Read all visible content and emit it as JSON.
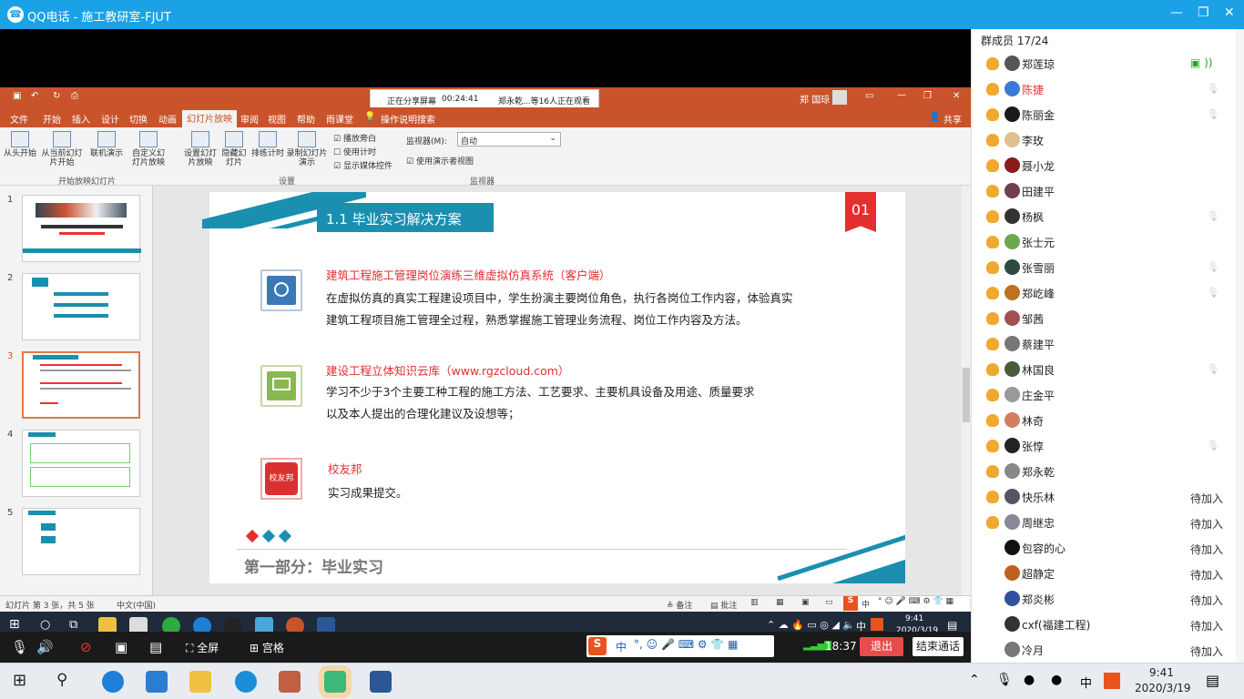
{
  "qq": {
    "title": "QQ电话 - 施工教研室-FJUT"
  },
  "ppt": {
    "share_status": "正在分享屏幕",
    "share_time": "00:24:41",
    "share_viewers": "郑永乾...等16人正在观看",
    "user": "郑 国琼",
    "share_btn": "共享",
    "tabs": [
      "文件",
      "开始",
      "插入",
      "设计",
      "切换",
      "动画",
      "幻灯片放映",
      "审阅",
      "视图",
      "帮助",
      "雨课堂"
    ],
    "tell_me": "操作说明搜索",
    "ribbon": {
      "from_start": "从头开始",
      "from_current": "从当前幻灯片开始",
      "online": "联机演示",
      "custom": "自定义幻灯片放映",
      "group1": "开始放映幻灯片",
      "setup": "设置幻灯片放映",
      "hide": "隐藏幻灯片",
      "rehearse": "排练计时",
      "record": "录制幻灯片演示",
      "chk_narration": "播放旁白",
      "chk_timing": "使用计时",
      "chk_media": "显示媒体控件",
      "group2": "设置",
      "monitor_label": "监视器(M):",
      "monitor_value": "自动",
      "presenter": "使用演示者视图",
      "group3": "监视器"
    },
    "thumb_numbers": [
      "1",
      "2",
      "3",
      "4",
      "5"
    ],
    "status": {
      "slide": "幻灯片 第 3 张，共 5 张",
      "lang": "中文(中国)",
      "notes": "备注",
      "comments": "批注"
    },
    "slide": {
      "section_title": "1.1 毕业实习解决方案",
      "badge": "01",
      "item1_title": "建筑工程施工管理岗位演练三维虚拟仿真系统（客户端）",
      "item1_line1": "在虚拟仿真的真实工程建设项目中，学生扮演主要岗位角色，执行各岗位工作内容，体验真实",
      "item1_line2": "建筑工程项目施工管理全过程，熟悉掌握施工管理业务流程、岗位工作内容及方法。",
      "item2_title": "建设工程立体知识云库（www.rgzcloud.com）",
      "item2_line1": "学习不少于3个主要工种工程的施工方法、工艺要求、主要机具设备及用途、质量要求",
      "item2_line2": "以及本人提出的合理化建议及设想等；",
      "item3_title": "校友邦",
      "item3_icon": "校友邦",
      "item3_line1": "实习成果提交。",
      "footer": "第一部分：毕业实习"
    },
    "inner_clock": {
      "time": "9:41",
      "date": "2020/3/19"
    },
    "inner_tray_lang": "中"
  },
  "call": {
    "fullscreen": "全屏",
    "grid": "宫格",
    "duration": "18:37",
    "exit": "退出",
    "end": "结束通话",
    "ime_lang": "中"
  },
  "members": {
    "header": "群成员 17/24",
    "list": [
      {
        "name": "郑莲琼",
        "status": "",
        "color": "#555",
        "red": false
      },
      {
        "name": "陈捷",
        "status": "",
        "color": "#3a7bd5",
        "red": true
      },
      {
        "name": "陈丽金",
        "status": "",
        "color": "#1a1a1a",
        "red": false
      },
      {
        "name": "李玫",
        "status": "",
        "color": "#e0c090",
        "red": false
      },
      {
        "name": "聂小龙",
        "status": "",
        "color": "#8b1a1a",
        "red": false
      },
      {
        "name": "田建平",
        "status": "",
        "color": "#704050",
        "red": false
      },
      {
        "name": "杨枫",
        "status": "",
        "color": "#333",
        "red": false
      },
      {
        "name": "张士元",
        "status": "",
        "color": "#6aa84f",
        "red": false
      },
      {
        "name": "张雪丽",
        "status": "",
        "color": "#2d4a3e",
        "red": false
      },
      {
        "name": "郑屹峰",
        "status": "",
        "color": "#c07020",
        "red": false
      },
      {
        "name": "邹茜",
        "status": "",
        "color": "#a05050",
        "red": false
      },
      {
        "name": "蔡建平",
        "status": "",
        "color": "#777",
        "red": false
      },
      {
        "name": "林国良",
        "status": "",
        "color": "#4a5a3a",
        "red": false
      },
      {
        "name": "庄金平",
        "status": "",
        "color": "#999",
        "red": false
      },
      {
        "name": "林奇",
        "status": "",
        "color": "#d08060",
        "red": false
      },
      {
        "name": "张惇",
        "status": "",
        "color": "#222",
        "red": false
      },
      {
        "name": "郑永乾",
        "status": "",
        "color": "#888",
        "red": false
      },
      {
        "name": "快乐林",
        "status": "待加入",
        "color": "#556",
        "red": false
      },
      {
        "name": "周继忠",
        "status": "待加入",
        "color": "#889",
        "red": false
      },
      {
        "name": "包容的心",
        "status": "待加入",
        "color": "#111",
        "red": false
      },
      {
        "name": "超静定",
        "status": "待加入",
        "color": "#c06020",
        "red": false
      },
      {
        "name": "郑炎彬",
        "status": "待加入",
        "color": "#3050a0",
        "red": false
      },
      {
        "name": "cxf(福建工程)",
        "status": "待加入",
        "color": "#333",
        "red": false
      },
      {
        "name": "冷月",
        "status": "待加入",
        "color": "#777",
        "red": false
      }
    ]
  },
  "taskbar": {
    "time": "9:41",
    "date": "2020/3/19",
    "lang": "中"
  }
}
